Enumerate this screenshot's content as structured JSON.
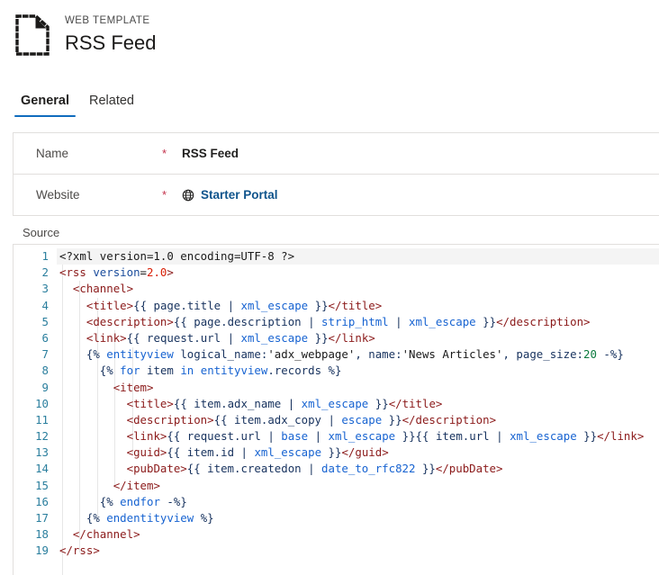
{
  "header": {
    "entity_type": "WEB TEMPLATE",
    "record_title": "RSS Feed",
    "icon": "web-template-document-icon"
  },
  "tabs": [
    {
      "label": "General",
      "active": true
    },
    {
      "label": "Related",
      "active": false
    }
  ],
  "form": {
    "rows": [
      {
        "label": "Name",
        "required": "*",
        "value": "RSS Feed",
        "type": "text"
      },
      {
        "label": "Website",
        "required": "*",
        "value": "Starter Portal",
        "type": "lookup",
        "icon": "globe-icon"
      }
    ]
  },
  "source": {
    "label": "Source",
    "accent_color": "#0f6cbd",
    "required_color": "#c4314b",
    "link_color": "#0f548c",
    "line_number_color": "#2b7f9e",
    "lines": [
      {
        "n": "1",
        "text": "<?xml version=1.0 encoding=UTF-8 ?>"
      },
      {
        "n": "2",
        "text": "<rss version=2.0>"
      },
      {
        "n": "3",
        "text": "  <channel>"
      },
      {
        "n": "4",
        "text": "    <title>{{ page.title | xml_escape }}</title>"
      },
      {
        "n": "5",
        "text": "    <description>{{ page.description | strip_html | xml_escape }}</description>"
      },
      {
        "n": "6",
        "text": "    <link>{{ request.url | xml_escape }}</link>"
      },
      {
        "n": "7",
        "text": "    {% entityview logical_name:'adx_webpage', name:'News Articles', page_size:20 -%}"
      },
      {
        "n": "8",
        "text": "      {% for item in entityview.records %}"
      },
      {
        "n": "9",
        "text": "        <item>"
      },
      {
        "n": "10",
        "text": "          <title>{{ item.adx_name | xml_escape }}</title>"
      },
      {
        "n": "11",
        "text": "          <description>{{ item.adx_copy | escape }}</description>"
      },
      {
        "n": "12",
        "text": "          <link>{{ request.url | base | xml_escape }}{{ item.url | xml_escape }}</link>"
      },
      {
        "n": "13",
        "text": "          <guid>{{ item.id | xml_escape }}</guid>"
      },
      {
        "n": "14",
        "text": "          <pubDate>{{ item.createdon | date_to_rfc822 }}</pubDate>"
      },
      {
        "n": "15",
        "text": "        </item>"
      },
      {
        "n": "16",
        "text": "      {% endfor -%}"
      },
      {
        "n": "17",
        "text": "    {% endentityview %}"
      },
      {
        "n": "18",
        "text": "  </channel>"
      },
      {
        "n": "19",
        "text": "</rss>"
      }
    ]
  }
}
